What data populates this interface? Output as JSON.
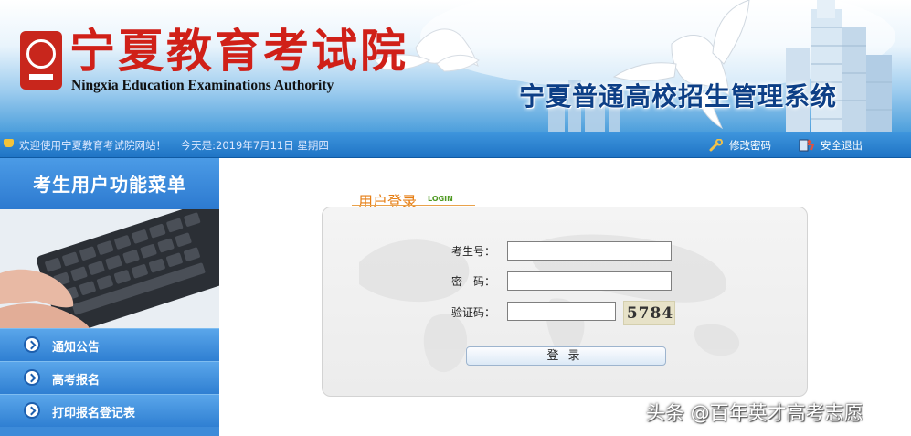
{
  "header": {
    "org_name_cn": "宁夏教育考试院",
    "org_name_en": "Ningxia Education Examinations Authority",
    "system_title": "宁夏普通高校招生管理系统"
  },
  "statusbar": {
    "welcome": "欢迎使用宁夏教育考试院网站！",
    "today": "今天是:2019年7月11日 星期四",
    "change_password": "修改密码",
    "logout": "安全退出",
    "icons": [
      "bell-icon",
      "wrench-icon",
      "logout-icon"
    ]
  },
  "sidebar": {
    "title": "考生用户功能菜单",
    "items": [
      {
        "label": "通知公告",
        "icon": "arrow-circle-icon"
      },
      {
        "label": "高考报名",
        "icon": "arrow-circle-icon"
      },
      {
        "label": "打印报名登记表",
        "icon": "arrow-circle-icon"
      }
    ]
  },
  "login": {
    "heading": "用户登录",
    "heading_en": "LOGIN",
    "examinee_label": "考生号：",
    "password_label": "密　码：",
    "captcha_label": "验证码：",
    "examinee_value": "",
    "password_value": "",
    "captcha_value": "",
    "captcha_image_text": "5784",
    "submit_label": "登录"
  },
  "watermark": "头条 @百年英才高考志愿",
  "colors": {
    "banner_blue": "#1f74c5",
    "seal_red": "#c8261c",
    "system_title": "#0d3f86",
    "login_heading": "#e67e14",
    "login_heading_en": "#4f9a22",
    "sidebar_blue": "#3d8bd9"
  }
}
